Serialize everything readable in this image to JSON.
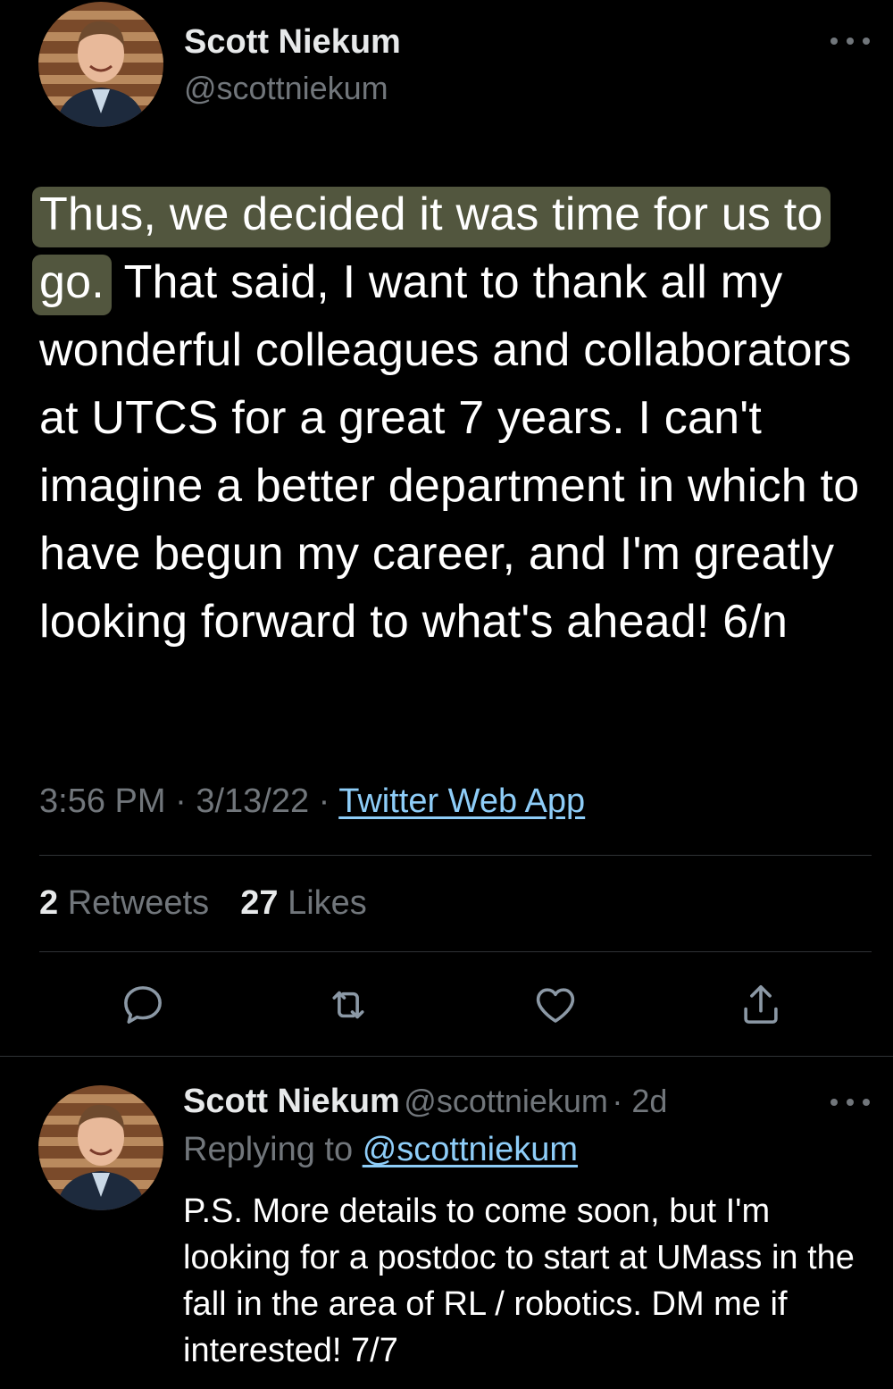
{
  "main_tweet": {
    "author_name": "Scott Niekum",
    "author_handle": "@scottniekum",
    "text_highlighted": "Thus, we decided it was time for us to go.",
    "text_rest": " That said, I want to thank all my wonderful colleagues and collaborators at UTCS for a great 7 years. I can't imagine a better department in which to have begun my career, and I'm greatly looking forward to what's ahead! 6/n",
    "time": "3:56 PM",
    "date": "3/13/22",
    "separator": "·",
    "source": "Twitter Web App",
    "retweet_count": "2",
    "retweet_label": "Retweets",
    "like_count": "27",
    "like_label": "Likes"
  },
  "actions": [
    {
      "icon": "reply-icon"
    },
    {
      "icon": "retweet-icon"
    },
    {
      "icon": "like-icon"
    },
    {
      "icon": "share-icon"
    }
  ],
  "reply_tweet": {
    "author_name": "Scott Niekum",
    "author_handle": "@scottniekum",
    "age": "· 2d",
    "replying_to_label": "Replying to",
    "replying_to_handle": "@scottniekum",
    "text": "P.S. More details to come soon, but I'm looking for a postdoc to start at UMass in the fall in the area of RL / robotics. DM me if interested! 7/7"
  },
  "colors": {
    "background": "#000000",
    "text": "#e7e9ea",
    "secondary": "#71767b",
    "link": "#8ecdf8",
    "highlight": "#c4cc94",
    "divider": "#2f3336"
  },
  "icons": {
    "more": "more-horizontal-icon",
    "avatar": "profile-avatar"
  }
}
